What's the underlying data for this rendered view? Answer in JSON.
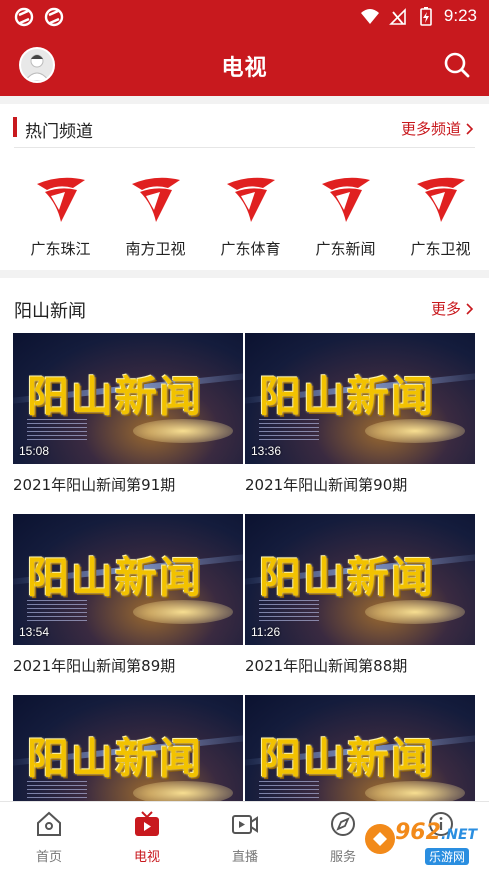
{
  "status_bar": {
    "time": "9:23"
  },
  "app_bar": {
    "title": "电视"
  },
  "hot_channels": {
    "heading": "热门频道",
    "more_label": "更多频道",
    "items": [
      {
        "name": "广东珠江"
      },
      {
        "name": "南方卫视"
      },
      {
        "name": "广东体育"
      },
      {
        "name": "广东新闻"
      },
      {
        "name": "广东卫视"
      }
    ]
  },
  "news_section": {
    "heading": "阳山新闻",
    "more_label": "更多",
    "thumbnail_logo_text": "阳山新闻",
    "videos": [
      {
        "title": "2021年阳山新闻第91期",
        "duration": "15:08"
      },
      {
        "title": "2021年阳山新闻第90期",
        "duration": "13:36"
      },
      {
        "title": "2021年阳山新闻第89期",
        "duration": "13:54"
      },
      {
        "title": "2021年阳山新闻第88期",
        "duration": "11:26"
      },
      {
        "title": "",
        "duration": ""
      },
      {
        "title": "",
        "duration": ""
      }
    ]
  },
  "tab_bar": {
    "tabs": [
      {
        "label": "首页",
        "icon": "home-icon",
        "active": false
      },
      {
        "label": "电视",
        "icon": "tv-icon",
        "active": true
      },
      {
        "label": "直播",
        "icon": "live-icon",
        "active": false
      },
      {
        "label": "服务",
        "icon": "compass-icon",
        "active": false
      },
      {
        "label": "",
        "icon": "info-icon",
        "active": false
      }
    ]
  },
  "watermark": {
    "number": "962",
    "suffix": ".NET",
    "site": "乐游网"
  },
  "colors": {
    "brand_red": "#c8191e",
    "channel_red": "#e02020"
  }
}
